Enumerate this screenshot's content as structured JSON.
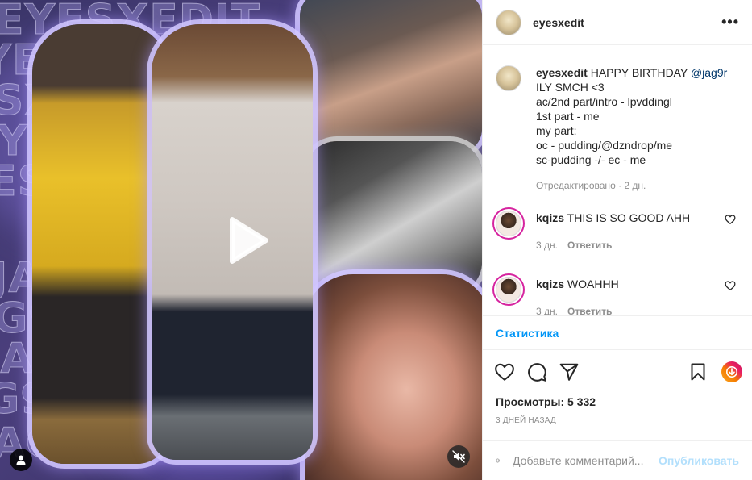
{
  "post": {
    "username": "eyesxedit"
  },
  "media": {
    "background_words": [
      "EYESXEDIT",
      "JAG9R"
    ],
    "play_icon": "play-icon",
    "mute_icon": "volume-muted-icon",
    "user_icon": "user-icon"
  },
  "caption": {
    "username": "eyesxedit",
    "text_before_mention": "HAPPY BIRTHDAY ",
    "mention": "@jag9r",
    "text_after_mention": " ILY SMCH <3",
    "lines": [
      "ac/2nd part/intro - lpvddingl",
      "1st part - me",
      "my part:",
      "oc - pudding/@dzndrop/me",
      "sc-pudding -/- ec - me"
    ],
    "meta": "Отредактировано · 2 дн."
  },
  "comments": [
    {
      "username": "kqizs",
      "text": "THIS IS SO GOOD AHH",
      "age": "3 дн.",
      "reply_label": "Ответить"
    },
    {
      "username": "kqizs",
      "text": "WOAHHH",
      "age": "3 дн.",
      "reply_label": "Ответить"
    }
  ],
  "stats_label": "Статистика",
  "views": "Просмотры: 5 332",
  "date": "3 ДНЕЙ НАЗАД",
  "add_comment": {
    "placeholder": "Добавьте комментарий...",
    "publish_label": "Опубликовать"
  },
  "colors": {
    "link_blue": "#0095f6",
    "mention_blue": "#00376b",
    "muted_gray": "#8e8e8e",
    "publish_disabled": "#b2dffc",
    "media_purple": "#4b3f7d"
  }
}
